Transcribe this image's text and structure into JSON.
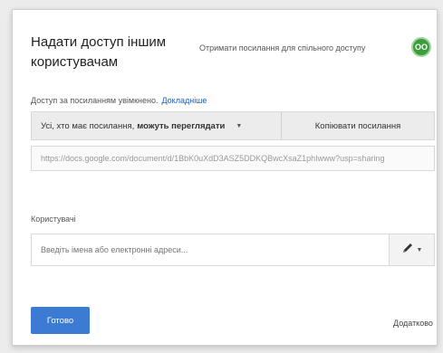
{
  "dialog": {
    "title": "Надати доступ іншим користувачам",
    "advanced_link": "Отримати посилання для спільного доступу",
    "avatar_label": "ОО"
  },
  "link_sharing": {
    "label": "Доступ за посиланням увімкнено.",
    "learn_more": "Докладніше",
    "access_prefix": "Усі, хто має посилання,",
    "access_level": "можуть переглядати",
    "copy_button": "Копіювати посилання",
    "url": "https://docs.google.com/document/d/1BbK0uXdD3ASZ5DDKQBwcXsaZ1phIwww?usp=sharing"
  },
  "people": {
    "label": "Користувачі",
    "placeholder": "Введіть імена або електронні адреси..."
  },
  "footer": {
    "done_button": "Готово",
    "advanced_button": "Додатково"
  },
  "colors": {
    "primary": "#3b7bd3",
    "badge": "#3c9d3c",
    "link": "#1a5fc8"
  }
}
